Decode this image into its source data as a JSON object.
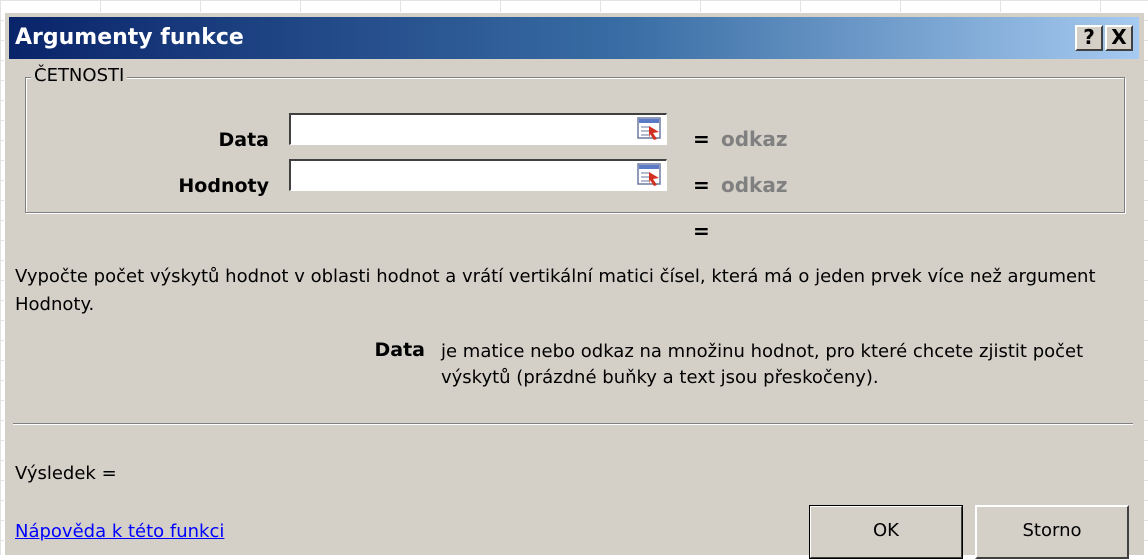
{
  "dialog": {
    "title": "Argumenty funkce",
    "help_button": "?",
    "close_button": "X"
  },
  "function": {
    "name": "ČETNOSTI",
    "args": [
      {
        "label": "Data",
        "value": "",
        "result": "odkaz"
      },
      {
        "label": "Hodnoty",
        "value": "",
        "result": "odkaz"
      }
    ],
    "equals_sign": "=",
    "formula_result": "",
    "description": "Vypočte počet výskytů hodnot v oblasti hodnot a vrátí vertikální matici čísel, která má o jeden prvek více než argument Hodnoty.",
    "current_arg_name": "Data",
    "current_arg_help": "je matice nebo odkaz na množinu hodnot, pro které chcete zjistit počet výskytů (prázdné buňky a text jsou přeskočeny)."
  },
  "footer": {
    "result_label": "Výsledek =",
    "help_link": "Nápověda k této funkci",
    "ok_label": "OK",
    "cancel_label": "Storno"
  },
  "colors": {
    "dialog_bg": "#d4d0c8",
    "title_start": "#0a246a",
    "title_end": "#a6caf0",
    "link": "#0000ff"
  }
}
